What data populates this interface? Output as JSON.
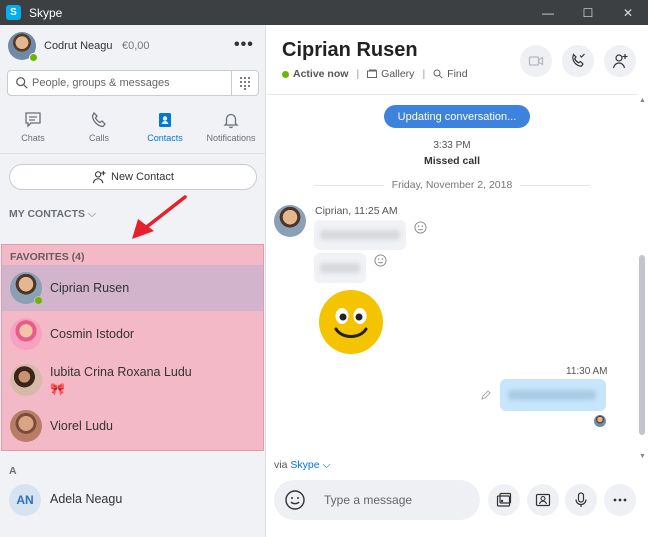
{
  "window": {
    "title": "Skype",
    "controls": {
      "minimize": "—",
      "maximize": "☐",
      "close": "✕"
    }
  },
  "profile": {
    "name": "Codrut Neagu",
    "credit": "€0,00",
    "more_icon": "more-icon"
  },
  "search": {
    "placeholder": "People, groups & messages"
  },
  "nav_tabs": [
    {
      "label": "Chats",
      "icon": "chat-icon"
    },
    {
      "label": "Calls",
      "icon": "phone-icon"
    },
    {
      "label": "Contacts",
      "icon": "contacts-icon",
      "active": true
    },
    {
      "label": "Notifications",
      "icon": "bell-icon"
    }
  ],
  "new_contact": {
    "label": "New Contact"
  },
  "my_contacts": {
    "label": "MY CONTACTS",
    "chevron": "⌵"
  },
  "favorites": {
    "header": "FAVORITES (4)",
    "contacts": [
      {
        "name": "Ciprian Rusen",
        "selected": true,
        "online": true
      },
      {
        "name": "Cosmin Istodor"
      },
      {
        "name": "Iubita Crina Roxana Ludu",
        "emoji": "🎀"
      },
      {
        "name": "Viorel Ludu"
      }
    ]
  },
  "section_a": {
    "letter": "A"
  },
  "contact_an": {
    "initials": "AN",
    "name": "Adela Neagu"
  },
  "conversation": {
    "title": "Ciprian Rusen",
    "status": "Active now",
    "gallery": "Gallery",
    "find": "Find",
    "updating": "Updating conversation...",
    "missed_time": "3:33 PM",
    "missed_label": "Missed call",
    "date": "Friday, November 2, 2018",
    "sender": "Ciprian, 11:25 AM",
    "outgoing_time": "11:30 AM",
    "via_prefix": "via",
    "via_link": "Skype",
    "via_chevron": "⌵",
    "composer_placeholder": "Type a message"
  },
  "colors": {
    "accent": "#0078d4",
    "online": "#6bb700",
    "favorites_highlight": "#f4b9c7",
    "selected_row": "#d2b5cc",
    "annotation_arrow": "#e8202a"
  }
}
